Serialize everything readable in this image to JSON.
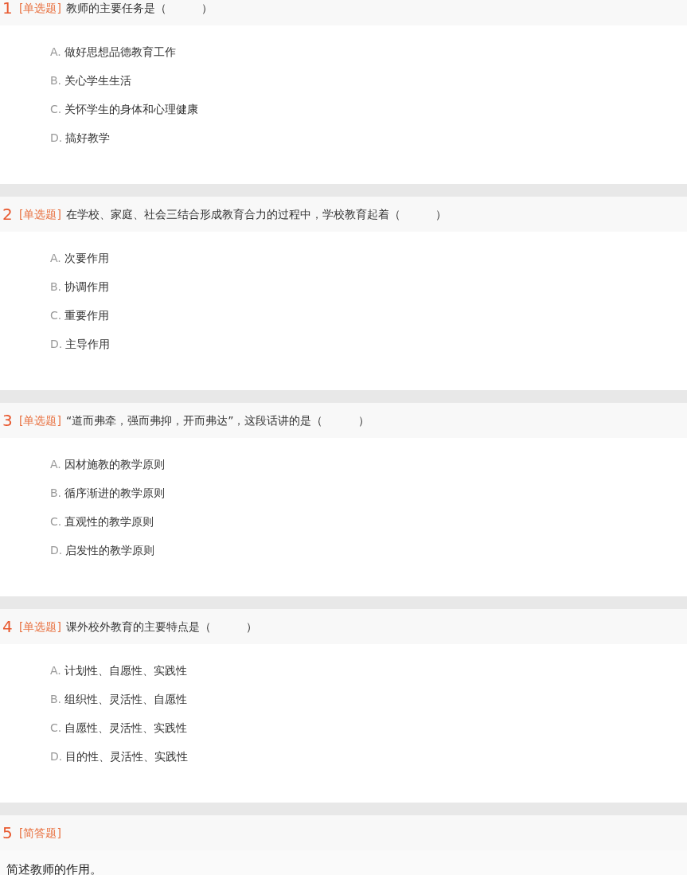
{
  "questions": [
    {
      "number": "1",
      "type": "[单选题]",
      "stem": "教师的主要任务是（          ）",
      "kind": "choice",
      "options": [
        {
          "letter": "A.",
          "text": "做好思想品德教育工作"
        },
        {
          "letter": "B.",
          "text": "关心学生生活"
        },
        {
          "letter": "C.",
          "text": "关怀学生的身体和心理健康"
        },
        {
          "letter": "D.",
          "text": "搞好教学"
        }
      ]
    },
    {
      "number": "2",
      "type": "[单选题]",
      "stem": "在学校、家庭、社会三结合形成教育合力的过程中，学校教育起着（          ）",
      "kind": "choice",
      "options": [
        {
          "letter": "A.",
          "text": "次要作用"
        },
        {
          "letter": "B.",
          "text": "协调作用"
        },
        {
          "letter": "C.",
          "text": "重要作用"
        },
        {
          "letter": "D.",
          "text": "主导作用"
        }
      ]
    },
    {
      "number": "3",
      "type": "[单选题]",
      "stem": "“道而弗牵，强而弗抑，开而弗达”，这段话讲的是（          ）",
      "kind": "choice",
      "options": [
        {
          "letter": "A.",
          "text": "因材施教的教学原则"
        },
        {
          "letter": "B.",
          "text": "循序渐进的教学原则"
        },
        {
          "letter": "C.",
          "text": "直观性的教学原则"
        },
        {
          "letter": "D.",
          "text": "启发性的教学原则"
        }
      ]
    },
    {
      "number": "4",
      "type": "[单选题]",
      "stem": "课外校外教育的主要特点是（          ）",
      "kind": "choice",
      "options": [
        {
          "letter": "A.",
          "text": "计划性、自愿性、实践性"
        },
        {
          "letter": "B.",
          "text": "组织性、灵活性、自愿性"
        },
        {
          "letter": "C.",
          "text": "自愿性、灵活性、实践性"
        },
        {
          "letter": "D.",
          "text": "目的性、灵活性、实践性"
        }
      ]
    },
    {
      "number": "5",
      "type": "[简答题]",
      "kind": "essay",
      "prompt": "简述教师的作用。"
    }
  ]
}
